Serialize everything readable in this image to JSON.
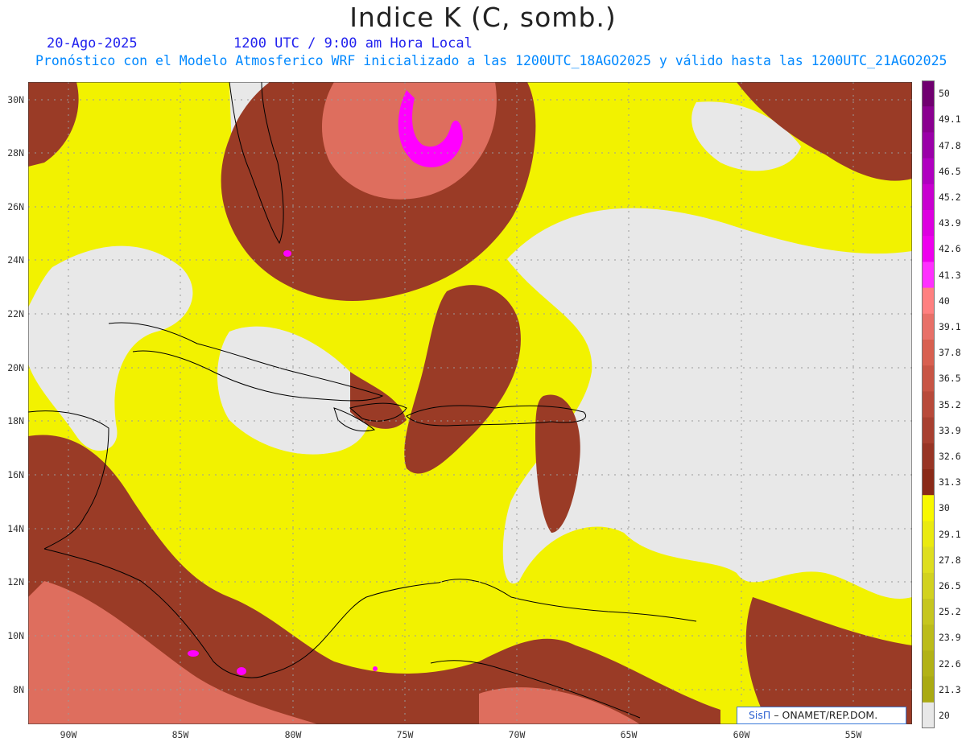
{
  "title": "Indice K (C, somb.)",
  "subtitle": {
    "date": "20-Ago-2025",
    "time": "1200 UTC / 9:00 am Hora Local",
    "forecast": "Pronóstico con el Modelo Atmosferico WRF inicializado a las 1200UTC_18AGO2025 y válido hasta las  1200UTC_21AGO2025"
  },
  "lat_labels": [
    "30N",
    "28N",
    "26N",
    "24N",
    "22N",
    "20N",
    "18N",
    "16N",
    "14N",
    "12N",
    "10N",
    "8N"
  ],
  "lon_labels": [
    "90W",
    "85W",
    "80W",
    "75W",
    "70W",
    "65W",
    "60W",
    "55W"
  ],
  "colorbar": {
    "labels": [
      "50",
      "49.1",
      "47.8",
      "46.5",
      "45.2",
      "43.9",
      "42.6",
      "41.3",
      "40",
      "39.1",
      "37.8",
      "36.5",
      "35.2",
      "33.9",
      "32.6",
      "31.3",
      "30",
      "29.1",
      "27.8",
      "26.5",
      "25.2",
      "23.9",
      "22.6",
      "21.3",
      "20"
    ],
    "colors": [
      "#700070",
      "#8a0090",
      "#9a00a8",
      "#b000c0",
      "#c800d0",
      "#dd00e0",
      "#ee00ee",
      "#ff30ff",
      "#ff8080",
      "#e87068",
      "#d86050",
      "#c85545",
      "#b84a3a",
      "#a84030",
      "#983525",
      "#8a2a18",
      "#f8f800",
      "#eaea10",
      "#dede20",
      "#d2d220",
      "#c6c620",
      "#bcbc1a",
      "#b2b216",
      "#aaaa12",
      "#e8e8e8"
    ]
  },
  "credit": {
    "logo": "SisΠ",
    "org": "– ONAMET/REP.DOM."
  },
  "colors": {
    "low": "#e8e8e8",
    "yellow": "#f2f200",
    "brown": "#9a3b26",
    "salmon": "#de6e5e",
    "magenta": "#ff00ff"
  }
}
